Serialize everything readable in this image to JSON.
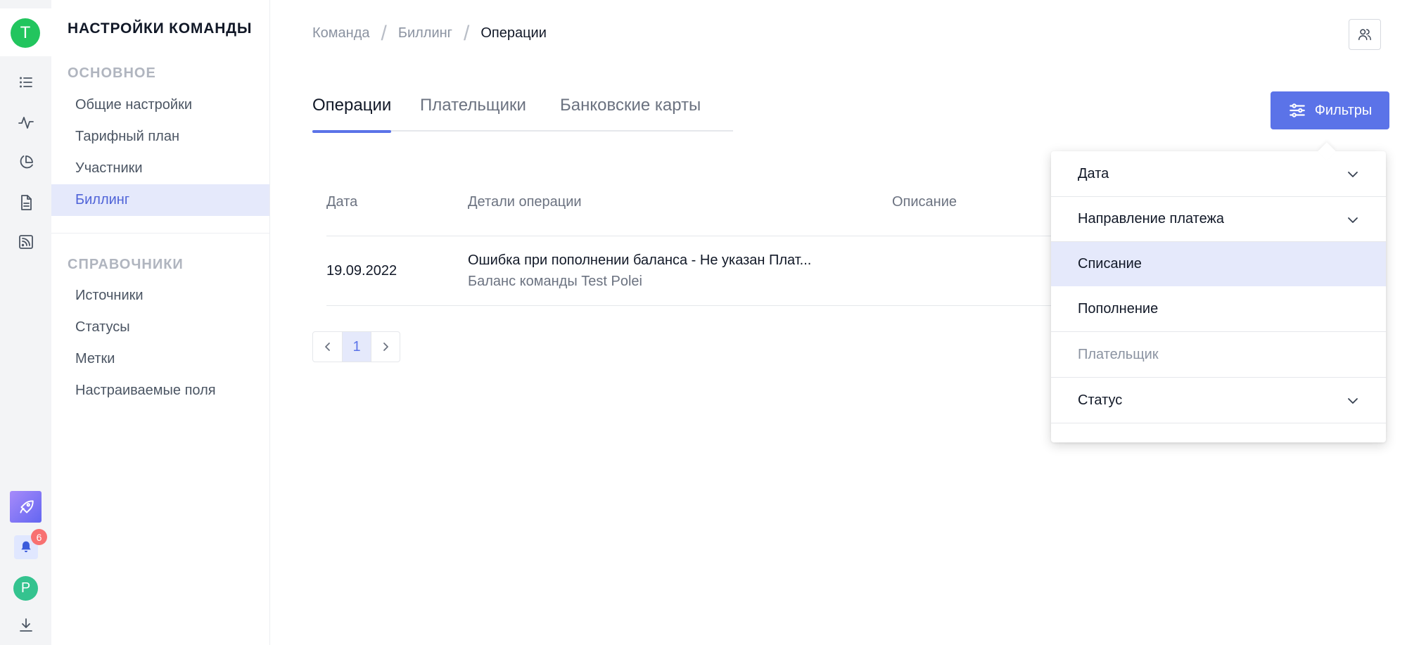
{
  "rail": {
    "team_initial": "T",
    "user_initial": "P",
    "notifications_count": "6",
    "icons": [
      "list-icon",
      "activity-icon",
      "pie-chart-icon",
      "document-icon",
      "rss-icon",
      "rocket-icon",
      "bell-icon",
      "download-icon"
    ]
  },
  "settings": {
    "title": "НАСТРОЙКИ КОМАНДЫ",
    "section_main": "ОСНОВНОЕ",
    "items_main": [
      "Общие настройки",
      "Тарифный план",
      "Участники",
      "Биллинг"
    ],
    "section_refs": "СПРАВОЧНИКИ",
    "items_refs": [
      "Источники",
      "Статусы",
      "Метки",
      "Настраиваемые поля"
    ]
  },
  "breadcrumb": [
    "Команда",
    "Биллинг",
    "Операции"
  ],
  "tabs": [
    "Операции",
    "Плательщики",
    "Банковские карты"
  ],
  "filters_button": "Фильтры",
  "table": {
    "columns": [
      "Дата",
      "Детали операции",
      "Описание"
    ],
    "rows": [
      {
        "date": "19.09.2022",
        "details": "Ошибка при пополнении баланса - Не указан Плат...",
        "details_sub": "Баланс команды Test Polei",
        "description": ""
      }
    ]
  },
  "pagination": {
    "current": "1"
  },
  "filters": {
    "date": "Дата",
    "direction": "Направление платежа",
    "direction_options": [
      "Списание",
      "Пополнение"
    ],
    "payer": "Плательщик",
    "status": "Статус"
  },
  "colors": {
    "accent": "#5b73e8",
    "active_bg": "#e5e9fb",
    "team_avatar": "#22c55e",
    "badge": "#f87171"
  }
}
